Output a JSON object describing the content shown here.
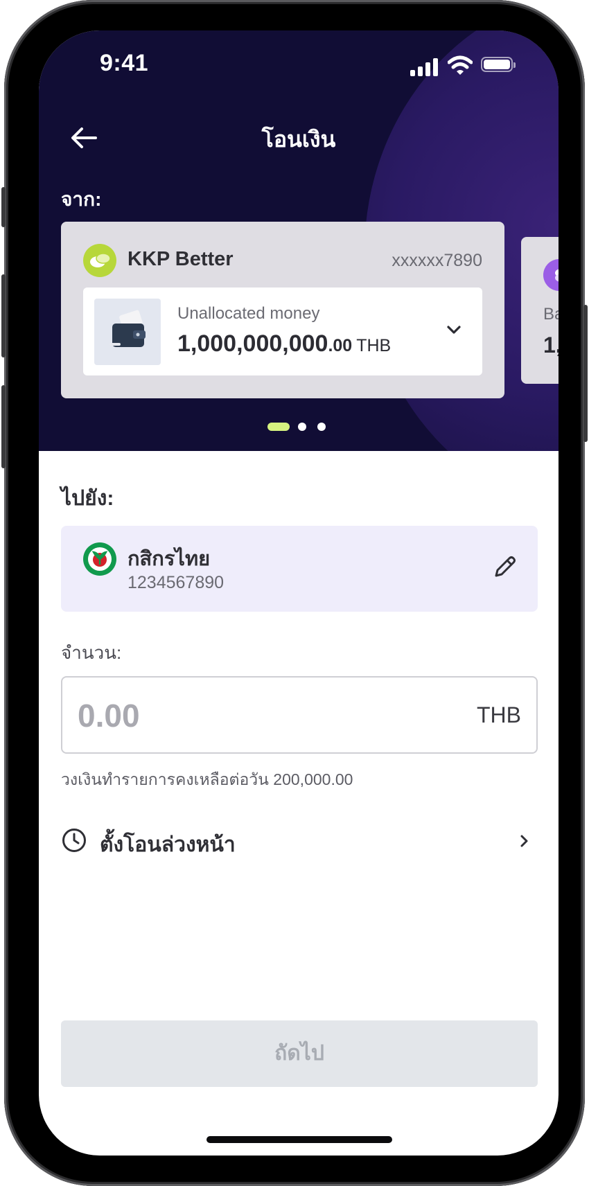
{
  "status_bar": {
    "time": "9:41"
  },
  "header": {
    "title": "โอนเงิน"
  },
  "from": {
    "label": "จาก:",
    "cards": [
      {
        "name": "KKP Better",
        "account": "xxxxxx7890",
        "sub_label": "Unallocated money",
        "amount_main": "1,000,000,000",
        "amount_decimal": ".00",
        "currency": "THB"
      },
      {
        "sub_label": "Ba",
        "amount_main": "1,"
      }
    ],
    "pager_count": 3,
    "pager_active": 0
  },
  "to": {
    "label": "ไปยัง:",
    "bank_name": "กสิกรไทย",
    "account": "1234567890"
  },
  "amount": {
    "label": "จำนวน:",
    "placeholder": "0.00",
    "currency": "THB",
    "limit_text": "วงเงินทำรายการคงเหลือต่อวัน 200,000.00"
  },
  "schedule": {
    "label": "ตั้งโอนล่วงหน้า"
  },
  "next_button": {
    "label": "ถัดไป"
  },
  "colors": {
    "header_bg": "#110d35",
    "accent_green": "#b7d73a",
    "kasikorn_green": "#119a4d",
    "button_disabled": "#e3e6ea"
  },
  "icons": [
    "back-arrow-icon",
    "signal-icon",
    "wifi-icon",
    "battery-icon",
    "coins-icon",
    "wallet-icon",
    "chevron-down-icon",
    "kasikorn-logo-icon",
    "pencil-icon",
    "clock-icon",
    "chevron-right-icon"
  ]
}
